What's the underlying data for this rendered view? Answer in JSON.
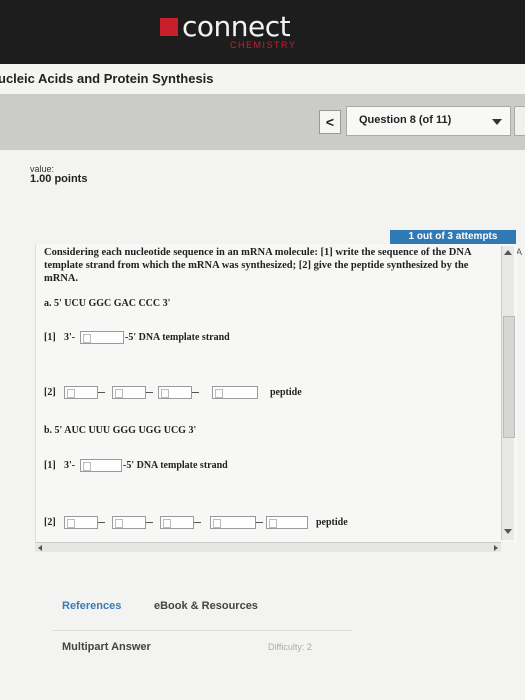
{
  "brand": {
    "name": "connect",
    "subject": "CHEMISTRY"
  },
  "assignment": {
    "title": "ucleic Acids and Protein Synthesis"
  },
  "navigation": {
    "prev_symbol": "<",
    "question_selector": "Question 8 (of 11)"
  },
  "value": {
    "label": "value:",
    "points": "1.00 points"
  },
  "attempts": "1 out of 3 attempts",
  "side_edge_char": "A",
  "question": {
    "prompt": "Considering each nucleotide sequence in an mRNA molecule: [1] write the sequence of the DNA template strand from which the mRNA was synthesized; [2] give the peptide synthesized by the mRNA.",
    "part_a": {
      "sequence": "a. 5' UCU GGC GAC CCC 3'",
      "row1_label": "[1]",
      "row1_prefix": "3'-",
      "row1_suffix": "-5'  DNA template strand",
      "row2_label": "[2]",
      "row2_suffix": "peptide"
    },
    "part_b": {
      "sequence": "b. 5' AUC UUU GGG UGG UCG 3'",
      "row1_label": "[1]",
      "row1_prefix": "3'-",
      "row1_suffix": "-5'  DNA template strand",
      "row2_label": "[2]",
      "row2_suffix": "peptide"
    }
  },
  "footer": {
    "references": "References",
    "ebook": "eBook & Resources",
    "multipart": "Multipart Answer",
    "difficulty": "Difficulty: 2"
  }
}
